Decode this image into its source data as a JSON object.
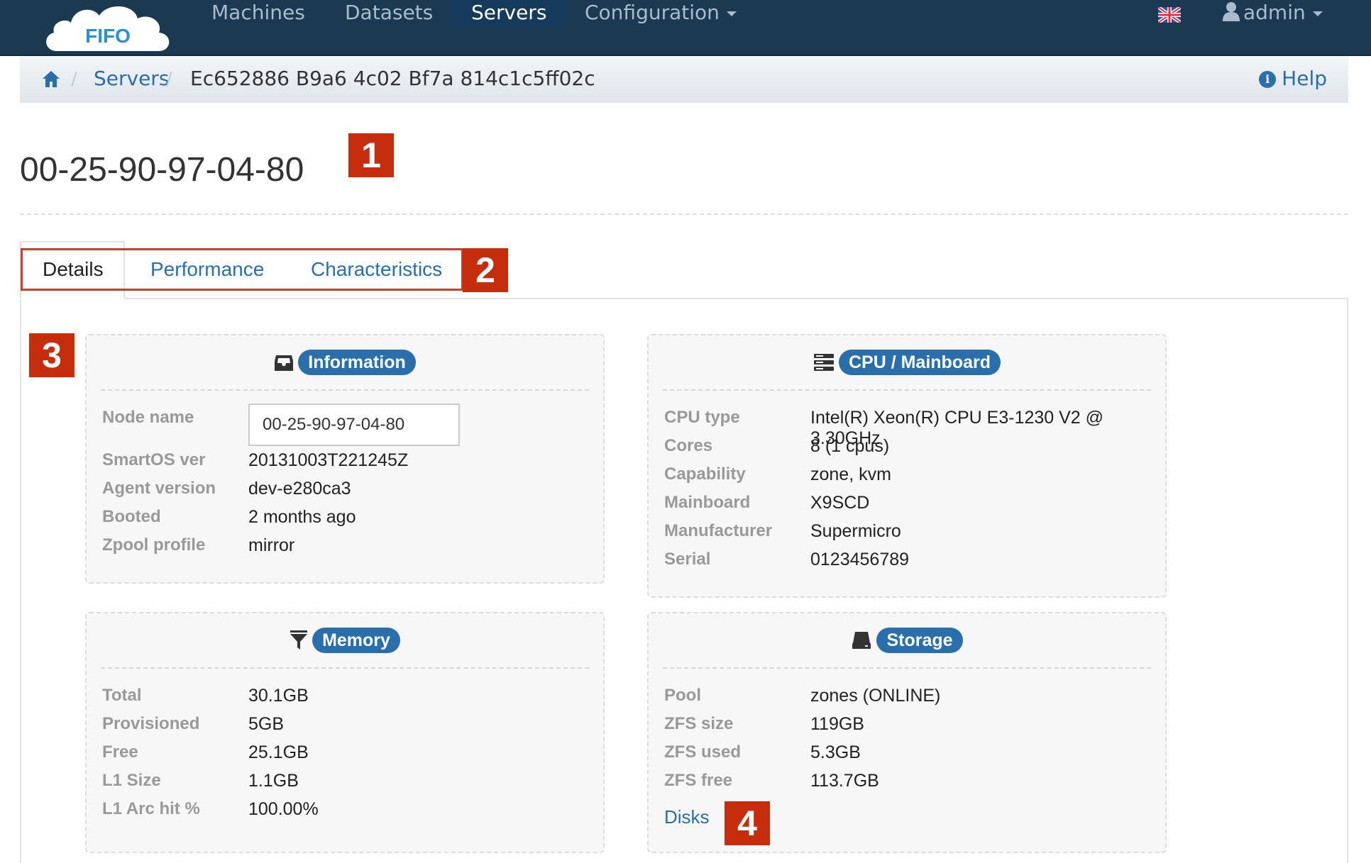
{
  "app": {
    "logo_text": "FIFO",
    "nav": [
      {
        "label": "Machines"
      },
      {
        "label": "Datasets"
      },
      {
        "label": "Servers"
      },
      {
        "label": "Configuration"
      }
    ],
    "user": "admin"
  },
  "breadcrumb": {
    "link": "Servers",
    "current": "Ec652886 B9a6 4c02 Bf7a 814c1c5ff02c",
    "help": "Help"
  },
  "page": {
    "title": "00-25-90-97-04-80"
  },
  "markers": [
    "1",
    "2",
    "3",
    "4"
  ],
  "tabs": [
    {
      "label": "Details"
    },
    {
      "label": "Performance"
    },
    {
      "label": "Characteristics"
    }
  ],
  "information": {
    "title": "Information",
    "rows": [
      {
        "label": "Node name",
        "value": "00-25-90-97-04-80"
      },
      {
        "label": "SmartOS ver",
        "value": "20131003T221245Z"
      },
      {
        "label": "Agent version",
        "value": "dev-e280ca3"
      },
      {
        "label": "Booted",
        "value": "2 months ago"
      },
      {
        "label": "Zpool profile",
        "value": "mirror"
      }
    ]
  },
  "cpu": {
    "title": "CPU / Mainboard",
    "rows": [
      {
        "label": "CPU type",
        "value": "Intel(R) Xeon(R) CPU E3-1230 V2 @ 3.30GHz"
      },
      {
        "label": "Cores",
        "value": "8 (1 cpus)"
      },
      {
        "label": "Capability",
        "value": "zone, kvm"
      },
      {
        "label": "Mainboard",
        "value": "X9SCD"
      },
      {
        "label": "Manufacturer",
        "value": "Supermicro"
      },
      {
        "label": "Serial",
        "value": "0123456789"
      }
    ]
  },
  "memory": {
    "title": "Memory",
    "rows": [
      {
        "label": "Total",
        "value": "30.1GB"
      },
      {
        "label": "Provisioned",
        "value": "5GB"
      },
      {
        "label": "Free",
        "value": "25.1GB"
      },
      {
        "label": "L1 Size",
        "value": "1.1GB"
      },
      {
        "label": "L1 Arc hit %",
        "value": "100.00%"
      }
    ]
  },
  "storage": {
    "title": "Storage",
    "rows": [
      {
        "label": "Pool",
        "value": "zones (ONLINE)"
      },
      {
        "label": "ZFS size",
        "value": "119GB"
      },
      {
        "label": "ZFS used",
        "value": "5.3GB"
      },
      {
        "label": "ZFS free",
        "value": "113.7GB"
      }
    ],
    "disks_link": "Disks"
  }
}
